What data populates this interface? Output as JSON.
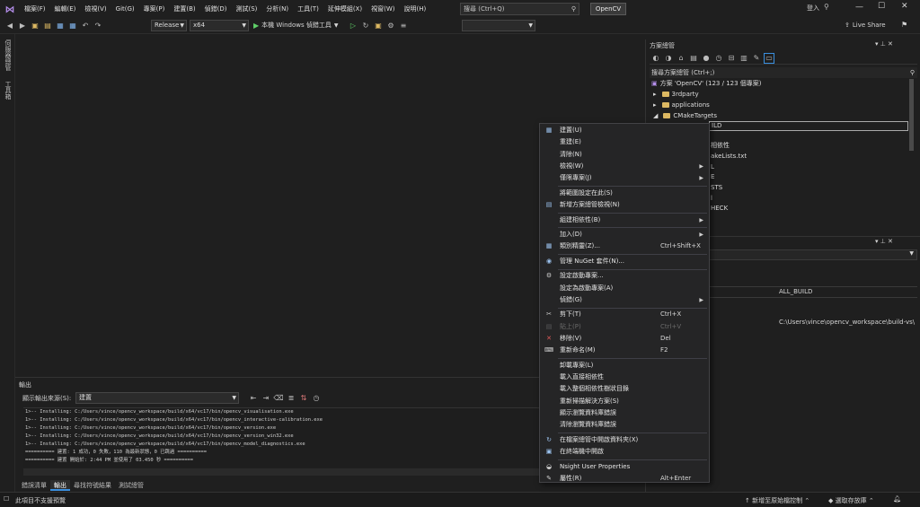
{
  "menubar": {
    "items": [
      "檔案(F)",
      "編輯(E)",
      "檢視(V)",
      "Git(G)",
      "專案(P)",
      "建置(B)",
      "偵錯(D)",
      "測試(S)",
      "分析(N)",
      "工具(T)",
      "延伸模組(X)",
      "視窗(W)",
      "說明(H)"
    ],
    "search_placeholder": "搜尋 (Ctrl+Q)",
    "project_name": "OpenCV",
    "signin": "登入",
    "live_share": "Live Share"
  },
  "toolbar": {
    "config": "Release",
    "platform": "x64",
    "run_label": "本機 Windows 偵錯工具"
  },
  "leftstrip": {
    "tab1": "伺服器總管",
    "tab2": "工具箱"
  },
  "output": {
    "title": "輸出",
    "source_label": "顯示輸出來源(S):",
    "source_value": "建置",
    "lines": [
      "1>-- Installing: C:/Users/vince/opencv_workspace/build/x64/vc17/bin/opencv_visualisation.exe",
      "1>-- Installing: C:/Users/vince/opencv_workspace/build/x64/vc17/bin/opencv_interactive-calibration.exe",
      "1>-- Installing: C:/Users/vince/opencv_workspace/build/x64/vc17/bin/opencv_version.exe",
      "1>-- Installing: C:/Users/vince/opencv_workspace/build/x64/vc17/bin/opencv_version_win32.exe",
      "1>-- Installing: C:/Users/vince/opencv_workspace/build/x64/vc17/bin/opencv_model_diagnostics.exe",
      "========== 建置: 1 成功，0 失敗，110 為最新狀態，0 已跳過 ==========",
      "========== 建置 開始於: 2:44 PM 並使用了 03.450 秒 =========="
    ]
  },
  "bottom_tabs": [
    "錯誤清單",
    "輸出",
    "尋找符號結果",
    "測試總管"
  ],
  "statusbar": {
    "left": "此項目不支援預覽",
    "add_source": "新增至原始檔控制",
    "select_repo": "選取存放庫"
  },
  "solution_explorer": {
    "title": "方案總管",
    "search_placeholder": "搜尋方案總管 (Ctrl+;)",
    "solution": "方案 'OpenCV' (123 / 123 個專案)",
    "items": [
      "3rdparty",
      "applications",
      "CMakeTargets"
    ],
    "selected_partial": "ILD",
    "hidden_partials": [
      "相依性",
      "akeLists.txt",
      "L",
      "E",
      "STS",
      "l",
      "HECK"
    ]
  },
  "properties": {
    "row1_value": "ALL_BUILD",
    "row2_value": "C:\\Users\\vince\\opencv_workspace\\build-vs\\"
  },
  "context_menu": {
    "items": [
      {
        "label": "建置(U)",
        "icon": "build-icon"
      },
      {
        "label": "重建(E)"
      },
      {
        "label": "清除(N)"
      },
      {
        "label": "檢視(W)",
        "arrow": true
      },
      {
        "label": "僅限專案(J)",
        "arrow": true
      },
      {
        "label": "將範圍設定在此(S)"
      },
      {
        "label": "新增方案總管檢視(N)",
        "icon": "new-view-icon"
      },
      {
        "label": "組建相依性(B)",
        "arrow": true
      },
      {
        "label": "加入(D)",
        "arrow": true
      },
      {
        "label": "類別精靈(Z)...",
        "shortcut": "Ctrl+Shift+X",
        "icon": "class-wizard-icon"
      },
      {
        "label": "管理 NuGet 套件(N)...",
        "icon": "nuget-icon"
      },
      {
        "label": "設定啟動專案...",
        "icon": "gear-icon"
      },
      {
        "label": "設定為啟動專案(A)"
      },
      {
        "label": "偵錯(G)",
        "arrow": true
      },
      {
        "label": "剪下(T)",
        "shortcut": "Ctrl+X",
        "icon": "cut-icon"
      },
      {
        "label": "貼上(P)",
        "shortcut": "Ctrl+V",
        "disabled": true,
        "icon": "paste-icon"
      },
      {
        "label": "移除(V)",
        "shortcut": "Del",
        "icon": "remove-icon"
      },
      {
        "label": "重新命名(M)",
        "shortcut": "F2",
        "icon": "rename-icon"
      },
      {
        "label": "卸載專案(L)"
      },
      {
        "label": "載入直接相依性"
      },
      {
        "label": "載入整個相依性樹狀目錄"
      },
      {
        "label": "重新掃描解決方案(S)"
      },
      {
        "label": "顯示瀏覽資料庫錯誤"
      },
      {
        "label": "清除瀏覽資料庫錯誤"
      },
      {
        "label": "在檔案總管中開啟資料夾(X)",
        "icon": "open-folder-icon"
      },
      {
        "label": "在終端機中開啟",
        "icon": "terminal-icon"
      },
      {
        "label": "Nsight User Properties",
        "icon": "nsight-icon"
      },
      {
        "label": "屬性(R)",
        "shortcut": "Alt+Enter",
        "icon": "wrench-icon"
      }
    ]
  }
}
